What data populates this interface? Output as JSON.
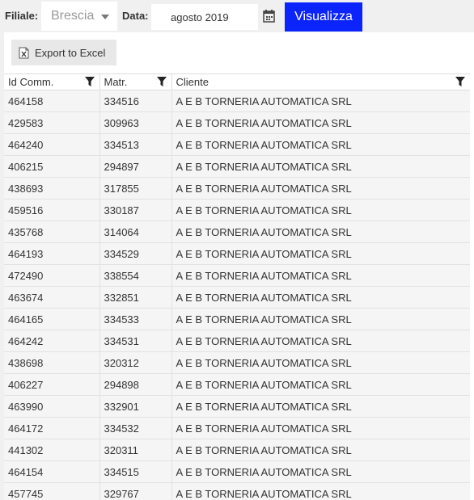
{
  "filters": {
    "filiale_label": "Filiale:",
    "filiale_value": "Brescia",
    "data_label": "Data:",
    "data_value": "agosto 2019",
    "submit_label": "Visualizza"
  },
  "grid": {
    "export_label": "Export to Excel",
    "columns": [
      "Id Comm.",
      "Matr.",
      "Cliente"
    ],
    "rows": [
      [
        "464158",
        "334516",
        "A E B TORNERIA AUTOMATICA SRL"
      ],
      [
        "429583",
        "309963",
        "A E B TORNERIA AUTOMATICA SRL"
      ],
      [
        "464240",
        "334513",
        "A E B TORNERIA AUTOMATICA SRL"
      ],
      [
        "406215",
        "294897",
        "A E B TORNERIA AUTOMATICA SRL"
      ],
      [
        "438693",
        "317855",
        "A E B TORNERIA AUTOMATICA SRL"
      ],
      [
        "459516",
        "330187",
        "A E B TORNERIA AUTOMATICA SRL"
      ],
      [
        "435768",
        "314064",
        "A E B TORNERIA AUTOMATICA SRL"
      ],
      [
        "464193",
        "334529",
        "A E B TORNERIA AUTOMATICA SRL"
      ],
      [
        "472490",
        "338554",
        "A E B TORNERIA AUTOMATICA SRL"
      ],
      [
        "463674",
        "332851",
        "A E B TORNERIA AUTOMATICA SRL"
      ],
      [
        "464165",
        "334533",
        "A E B TORNERIA AUTOMATICA SRL"
      ],
      [
        "464242",
        "334531",
        "A E B TORNERIA AUTOMATICA SRL"
      ],
      [
        "438698",
        "320312",
        "A E B TORNERIA AUTOMATICA SRL"
      ],
      [
        "406227",
        "294898",
        "A E B TORNERIA AUTOMATICA SRL"
      ],
      [
        "463990",
        "332901",
        "A E B TORNERIA AUTOMATICA SRL"
      ],
      [
        "464172",
        "334532",
        "A E B TORNERIA AUTOMATICA SRL"
      ],
      [
        "441302",
        "320311",
        "A E B TORNERIA AUTOMATICA SRL"
      ],
      [
        "464154",
        "334515",
        "A E B TORNERIA AUTOMATICA SRL"
      ],
      [
        "457745",
        "329767",
        "A E B TORNERIA AUTOMATICA SRL"
      ]
    ]
  },
  "icons": {
    "dropdown": "chevron-down-icon",
    "calendar": "calendar-icon",
    "excel": "excel-file-icon",
    "filter": "filter-icon"
  },
  "colors": {
    "accent_button": "#0b24fb",
    "page_background": "#f0f0f0",
    "row_background": "#f5f5f5"
  }
}
